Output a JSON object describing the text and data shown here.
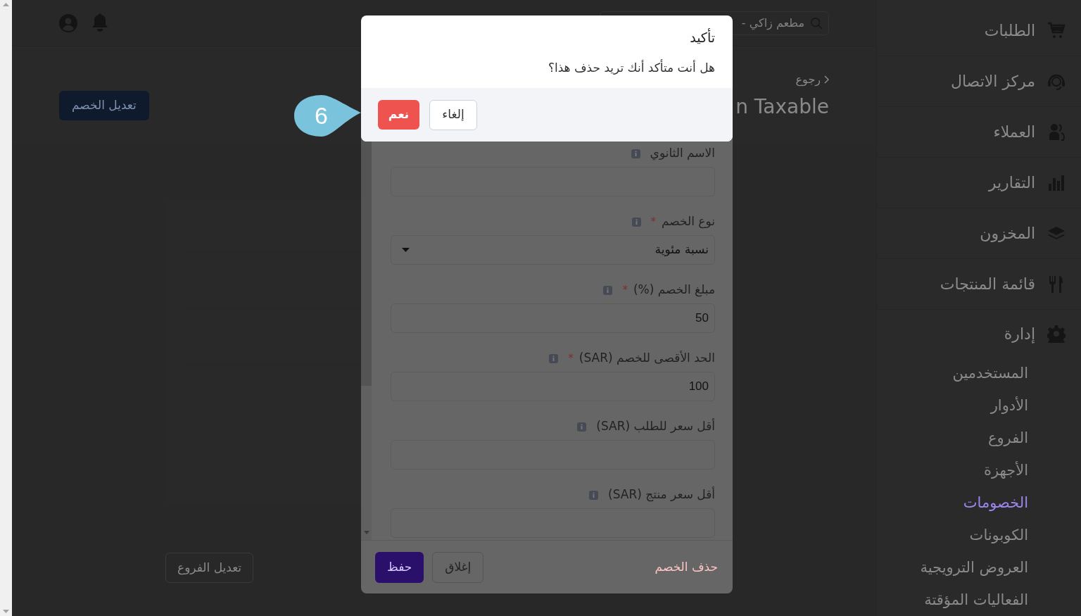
{
  "header": {
    "search_value": "مطعم زاكي -"
  },
  "page": {
    "back_link": "رجوع",
    "title": "n Taxable",
    "edit_button": "تعديل الخصم",
    "branches_button": "تعديل الفروع"
  },
  "sidebar": {
    "items": [
      {
        "label": "الطلبات"
      },
      {
        "label": "مركز الاتصال"
      },
      {
        "label": "العملاء"
      },
      {
        "label": "التقارير"
      },
      {
        "label": "المخزون"
      },
      {
        "label": "قائمة المنتجات"
      }
    ],
    "admin": {
      "label": "إدارة",
      "children": [
        {
          "label": "المستخدمين",
          "selected": false
        },
        {
          "label": "الأدوار",
          "selected": false
        },
        {
          "label": "الفروع",
          "selected": false
        },
        {
          "label": "الأجهزة",
          "selected": false
        },
        {
          "label": "الخصومات",
          "selected": true
        },
        {
          "label": "الكوبونات",
          "selected": false
        },
        {
          "label": "العروض الترويجية",
          "selected": false
        },
        {
          "label": "الفعاليات المؤقتة",
          "selected": false
        }
      ]
    }
  },
  "form_modal": {
    "fields": [
      {
        "label": "الاسم الثانوي",
        "kind": "text"
      },
      {
        "label": "نوع الخصم",
        "required_mark": "*",
        "kind": "select",
        "value": "نسبة مئوية"
      },
      {
        "label": "مبلغ الخصم (%)",
        "required_mark": "*",
        "kind": "text",
        "value": "50"
      },
      {
        "label": "الحد الأقصى للخصم (SAR)",
        "required_mark": "*",
        "kind": "text",
        "value": "100"
      },
      {
        "label": "أقل سعر للطلب (SAR)",
        "kind": "text"
      },
      {
        "label": "أقل سعر منتج (SAR)",
        "kind": "text"
      }
    ],
    "delete_link": "حذف الخصم",
    "close_button": "إغلاق",
    "save_button": "حفظ"
  },
  "confirm_dialog": {
    "title": "تأكيد",
    "message": "هل أنت متأكد أنك تريد حذف هذا؟",
    "cancel_button": "إلغاء",
    "confirm_button": "نعم"
  },
  "callout": {
    "number": "6"
  }
}
